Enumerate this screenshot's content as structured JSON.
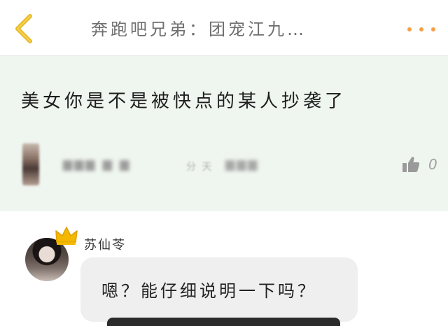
{
  "header": {
    "title": "奔跑吧兄弟：团宠江九…",
    "back_icon": "chevron-left-icon",
    "more_icon": "more-dots-icon",
    "accent_color": "#f5a04a"
  },
  "quoted_comment": {
    "text": "美女你是不是被快点的某人抄袭了",
    "blurred_name": "▆▆▆ ▆ ▆",
    "blurred_time": "分 天",
    "blurred_tail": "▆▆▆",
    "like_count": "0",
    "like_icon": "thumbs-up-icon",
    "background_color": "#eff5ef"
  },
  "reply": {
    "author": "苏仙苓",
    "message": "嗯？能仔细说明一下吗？",
    "crown_icon": "crown-icon",
    "crown_color": "#f5b800",
    "bubble_color": "#efefef"
  }
}
